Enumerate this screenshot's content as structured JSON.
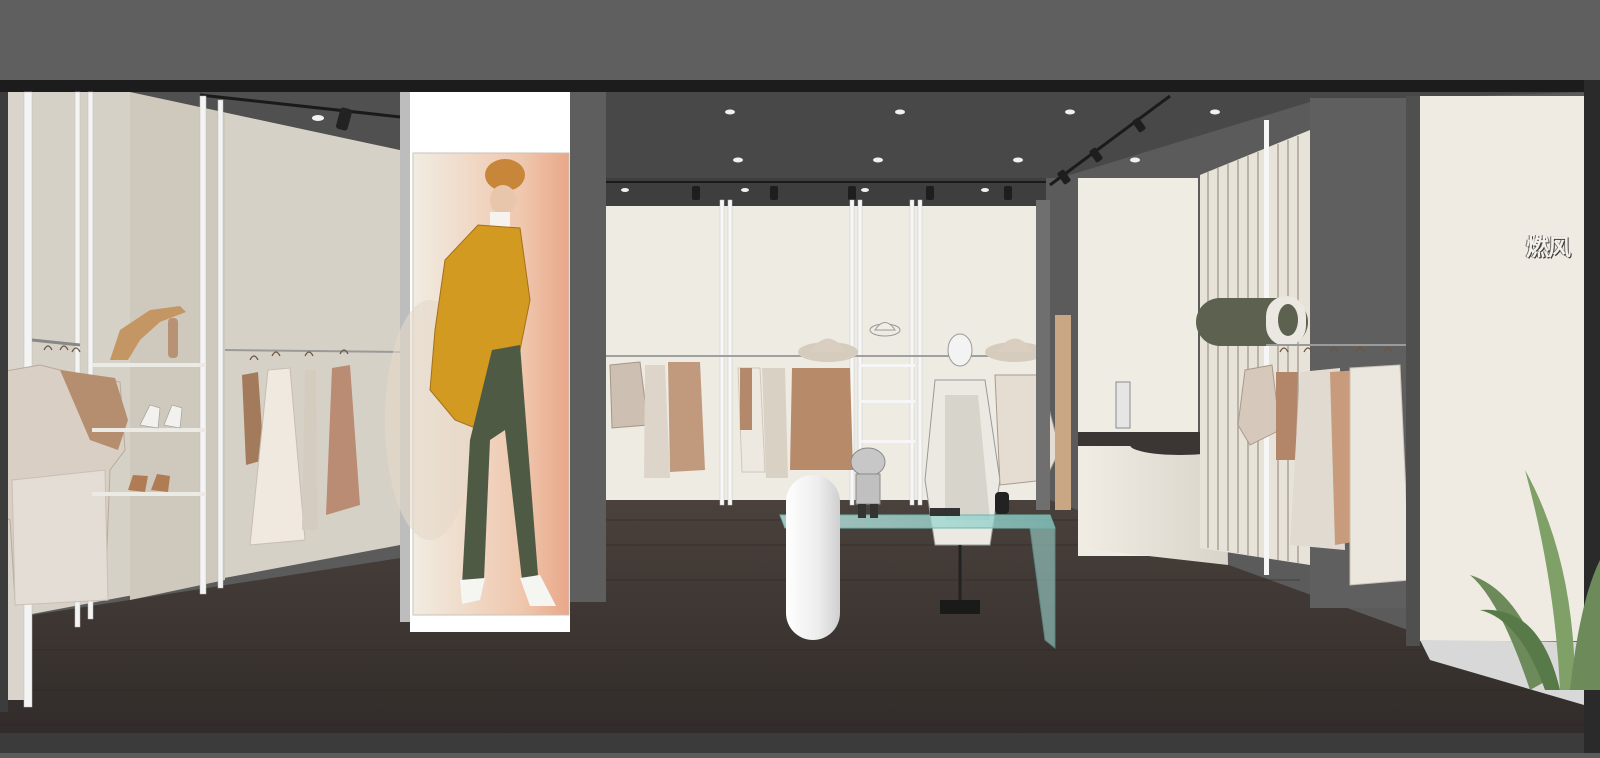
{
  "scene": {
    "description_free": true,
    "brand_sign_text": "燃风",
    "colors": {
      "ceiling": "#5b5b5b",
      "wall_cream": "#eeebe3",
      "wall_beige": "#d6d1c6",
      "floor": "#3a3330",
      "glass": "#9fd6d0",
      "coat": "#d39a22",
      "pants": "#4f5a45"
    }
  }
}
